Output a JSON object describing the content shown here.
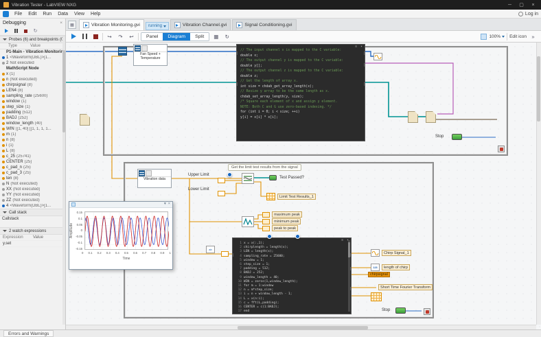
{
  "colors": {
    "accent": "#1b7fd4",
    "wire_dbl": "#2a6cc4",
    "wire_waveform": "#009393",
    "wire_numeric": "#e09100",
    "wire_error": "#7a6a52",
    "wire_reference": "#b85cb8",
    "led_on": "#3d9e3d",
    "code_background": "#2b2b2b"
  },
  "titlebar": {
    "title": "Vibration Tester - LabVIEW NXG",
    "minimize": "─",
    "maximize": "▢",
    "close": "×"
  },
  "menubar": {
    "items": [
      "File",
      "Edit",
      "Run",
      "Data",
      "View",
      "Help"
    ],
    "login_label": "Log in"
  },
  "tabbar": {
    "tabs": [
      {
        "label": "Vibration Monitoring.gvi",
        "badge": "running"
      },
      {
        "label": "Vibration Channel.gvi",
        "badge": ""
      },
      {
        "label": "Signal Conditioning.gvi",
        "badge": ""
      }
    ]
  },
  "toolbar": {
    "segments": [
      {
        "label": "Panel"
      },
      {
        "label": "Diagram"
      },
      {
        "label": "Split"
      }
    ],
    "zoom": "100%",
    "edit_icon_label": "Edit icon"
  },
  "sidebar": {
    "title": "Debugging",
    "probes_header": "Probes (6) and breakpoints (0)",
    "col_type": "Type",
    "col_value": "Value",
    "rows": [
      {
        "kind": "group",
        "type": "P1-Main - Vibration Monitoring.gvi",
        "value": ""
      },
      {
        "dot": "#1565c0",
        "type": "1",
        "value": "<Waveform(DBL)>[1..."
      },
      {
        "dot": "#9e9e9e",
        "type": "2",
        "value": "Not executed"
      },
      {
        "kind": "group",
        "type": "MathScript Node",
        "value": ""
      },
      {
        "dot": "#e09100",
        "type": "x",
        "value": "(1)"
      },
      {
        "dot": "#e09100",
        "type": "n",
        "value": "(Not executed)"
      },
      {
        "dot": "#e09100",
        "type": "chirpsignal",
        "value": "(8)"
      },
      {
        "dot": "#e09100",
        "type": "LEN4",
        "value": "(8)"
      },
      {
        "dot": "#e09100",
        "type": "sampling_rate",
        "value": "(25600)"
      },
      {
        "dot": "#e09100",
        "type": "window",
        "value": "(1)"
      },
      {
        "dot": "#e09100",
        "type": "step_size",
        "value": "(1)"
      },
      {
        "dot": "#e09100",
        "type": "padding",
        "value": "(512)"
      },
      {
        "dot": "#e09100",
        "type": "BADJ",
        "value": "(252)"
      },
      {
        "dot": "#e09100",
        "type": "window_length",
        "value": "(40)"
      },
      {
        "dot": "#e09100",
        "type": "WIN",
        "value": "([1, 40] [[1, 1, 1, 1..."
      },
      {
        "dot": "#e09100",
        "type": "m",
        "value": "(1)"
      },
      {
        "dot": "#e09100",
        "type": "n",
        "value": "(8)"
      },
      {
        "dot": "#e09100",
        "type": "i",
        "value": "(1)"
      },
      {
        "dot": "#e09100",
        "type": "L",
        "value": "(8)"
      },
      {
        "dot": "#e09100",
        "type": "c_25",
        "value": "(25741)"
      },
      {
        "dot": "#e09100",
        "type": "CENTER",
        "value": "(25)"
      },
      {
        "dot": "#e09100",
        "type": "c_pad_n",
        "value": "(25)"
      },
      {
        "dot": "#e09100",
        "type": "c_pad_3",
        "value": "(25)"
      },
      {
        "dot": "#e09100",
        "type": "ten",
        "value": "(8)"
      },
      {
        "dot": "#9e9e9e",
        "type": "N",
        "value": "(Not executed)"
      },
      {
        "dot": "#9e9e9e",
        "type": "XX",
        "value": "(Not executed)"
      },
      {
        "dot": "#9e9e9e",
        "type": "YY",
        "value": "(Not executed)"
      },
      {
        "dot": "#9e9e9e",
        "type": "ZZ",
        "value": "(Not executed)"
      },
      {
        "dot": "#1565c0",
        "type": "4",
        "value": "<Waveform(DBL)>[1..."
      }
    ],
    "callstack_header": "Call stack",
    "callstack_item": "Callstack",
    "watch_header": "2 watch expressions",
    "watch_col_expression": "Expression",
    "watch_col_value": "Value",
    "watch_rows": [
      {
        "expression": "y.set",
        "value": ""
      }
    ]
  },
  "canvas": {
    "loop1": {
      "fan_label_1": "Fan Speed +",
      "fan_label_2": "Temperature",
      "stop_label": "Stop"
    },
    "script_c": {
      "lines": [
        {
          "c": "cmt",
          "t": "// The input channel x is mapped to the C variable:"
        },
        {
          "c": "src",
          "t": "double x;"
        },
        {
          "c": "cmt",
          "t": "// The output channel y is mapped to the C variable:"
        },
        {
          "c": "src",
          "t": "double y[];"
        },
        {
          "c": "cmt",
          "t": "// The output channel z is mapped to the C variable:"
        },
        {
          "c": "src",
          "t": "double z;"
        },
        {
          "c": "src",
          "t": ""
        },
        {
          "c": "cmt",
          "t": "// Get the length of array x."
        },
        {
          "c": "src",
          "t": "int size = chdab_get_array_length(x);"
        },
        {
          "c": "src",
          "t": ""
        },
        {
          "c": "cmt",
          "t": "// Resize y array to be the same length as x."
        },
        {
          "c": "src",
          "t": "chdab_set_array_length(y, size);"
        },
        {
          "c": "src",
          "t": ""
        },
        {
          "c": "cmt",
          "t": "/* Square each element of x and assign y element."
        },
        {
          "c": "cmt",
          "t": "   NOTE: Both C and G use zero-based indexing. */"
        },
        {
          "c": "src",
          "t": "for (int i = 0; i < size; ++i)"
        },
        {
          "c": "src",
          "t": "    y[i] = x[i] * x[i];"
        }
      ]
    },
    "loop2": {
      "source_label": "Vibration data",
      "comment": "Get the limit test results from the signal",
      "upper_limit": "Upper Limit",
      "lower_limit": "Lower Limit",
      "test_passed": "Test Passed?",
      "limit_results": "Limit Test Results_1",
      "max_peak": "maximum peak",
      "min_peak": "minimum peak",
      "peak_to_peak": "peak to peak",
      "chirp_signal": "Chirp Signal_1",
      "length_of_chirp": "length of chirp",
      "chirpsignal_tag": "chirpsignal",
      "stft": "Short Time Fourier Transform",
      "stop_label": "Stop"
    },
    "script_m": {
      "lines": [
        {
          "n": "1",
          "t": "x = x(:,1);"
        },
        {
          "n": "2",
          "t": "chirplength = length(x);"
        },
        {
          "n": "3",
          "t": "LEN = length(x);"
        },
        {
          "n": "4",
          "t": "sampling_rate = 25600;"
        },
        {
          "n": "5",
          "t": "window = 1;"
        },
        {
          "n": "6",
          "t": "step_size = 1;"
        },
        {
          "n": "7",
          "t": "padding = 512;"
        },
        {
          "n": "8",
          "t": "BADJ = 252;"
        },
        {
          "n": "9",
          "t": "window_length = 40;"
        },
        {
          "n": "10",
          "t": "WIN = zeros(1,window_length);"
        },
        {
          "n": "11",
          "t": "for m = 1:window"
        },
        {
          "n": "12",
          "t": "    n = m*step_size;"
        },
        {
          "n": "13",
          "t": "    i = n + window_length - 1;"
        },
        {
          "n": "14",
          "t": "    L = x(n:i);"
        },
        {
          "n": "15",
          "t": "    c = fft(L,padding);"
        },
        {
          "n": "16",
          "t": "    CENTER = c(1:BADJ);"
        },
        {
          "n": "17",
          "t": "end"
        }
      ]
    },
    "probe_window": {
      "ylabel": "Amplitude",
      "xlabel": "Time",
      "yticks": [
        "0.15",
        "0.1",
        "0.05",
        "0",
        "-0.05",
        "-0.1",
        "-0.15"
      ],
      "xticks": [
        "0",
        "0.1",
        "0.2",
        "0.3",
        "0.4",
        "0.5",
        "0.6",
        "0.7",
        "0.8",
        "0.9",
        "1"
      ]
    }
  },
  "statusbar": {
    "errors_tab": "Errors and Warnings"
  }
}
